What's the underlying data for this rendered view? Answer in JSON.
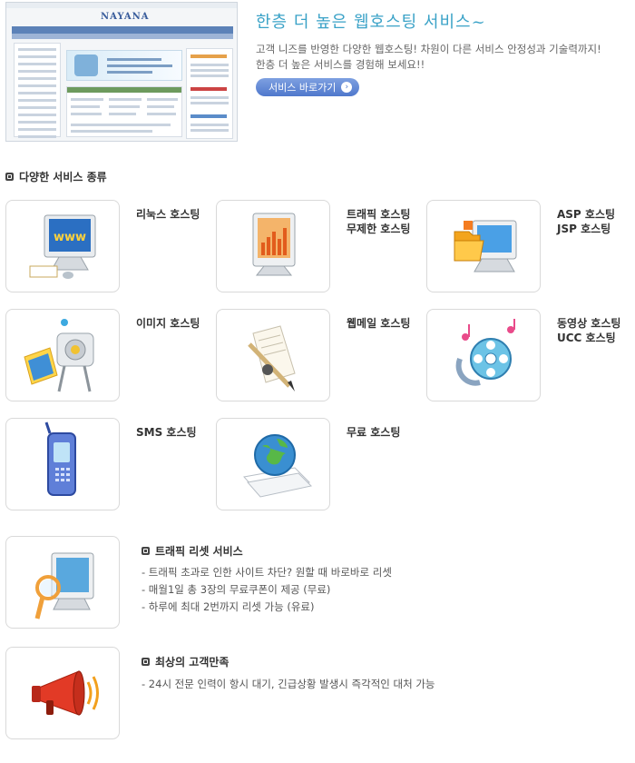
{
  "promo": {
    "title": "한층 더 높은 웹호스팅 서비스~",
    "desc_line1": "고객 니즈를 반영한 다양한 웹호스팅! 차원이 다른 서비스 안정성과 기술력까지!",
    "desc_line2": "한층 더 높은 서비스를 경험해 보세요!!",
    "button_label": "서비스 바로가기",
    "screenshot_logo": "NAYANA"
  },
  "services": {
    "heading": "다양한 서비스 종류",
    "items": [
      {
        "label": "리눅스 호스팅",
        "icon": "monitor-www-icon"
      },
      {
        "label": "트래픽 호스팅\n무제한 호스팅",
        "icon": "monitor-chart-icon"
      },
      {
        "label": "ASP 호스팅\nJSP 호스팅",
        "icon": "monitor-folder-icon"
      },
      {
        "label": "이미지 호스팅",
        "icon": "projector-icon"
      },
      {
        "label": "웹메일 호스팅",
        "icon": "pen-letter-icon"
      },
      {
        "label": "동영상 호스팅\nUCC 호스팅",
        "icon": "film-reel-icon"
      },
      {
        "label": "SMS 호스팅",
        "icon": "mobile-phone-icon"
      },
      {
        "label": "무료 호스팅",
        "icon": "globe-documents-icon"
      }
    ]
  },
  "features": [
    {
      "title": "트래픽 리셋 서비스",
      "icon": "monitor-magnifier-icon",
      "items": [
        "- 트래픽 초과로 인한 사이트 차단? 원할 때 바로바로 리셋",
        "- 매월1일 총 3장의 무료쿠폰이 제공 (무료)",
        "- 하루에 최대 2번까지 리셋 가능 (유료)"
      ]
    },
    {
      "title": "최상의 고객만족",
      "icon": "megaphone-icon",
      "items": [
        "- 24시 전문 인력이 항시 대기, 긴급상황 발생시 즉각적인 대처 가능"
      ]
    }
  ],
  "colors": {
    "promo_title": "#3aa2c7",
    "button": "#5b81d4",
    "card_border": "#d9d9d9"
  }
}
